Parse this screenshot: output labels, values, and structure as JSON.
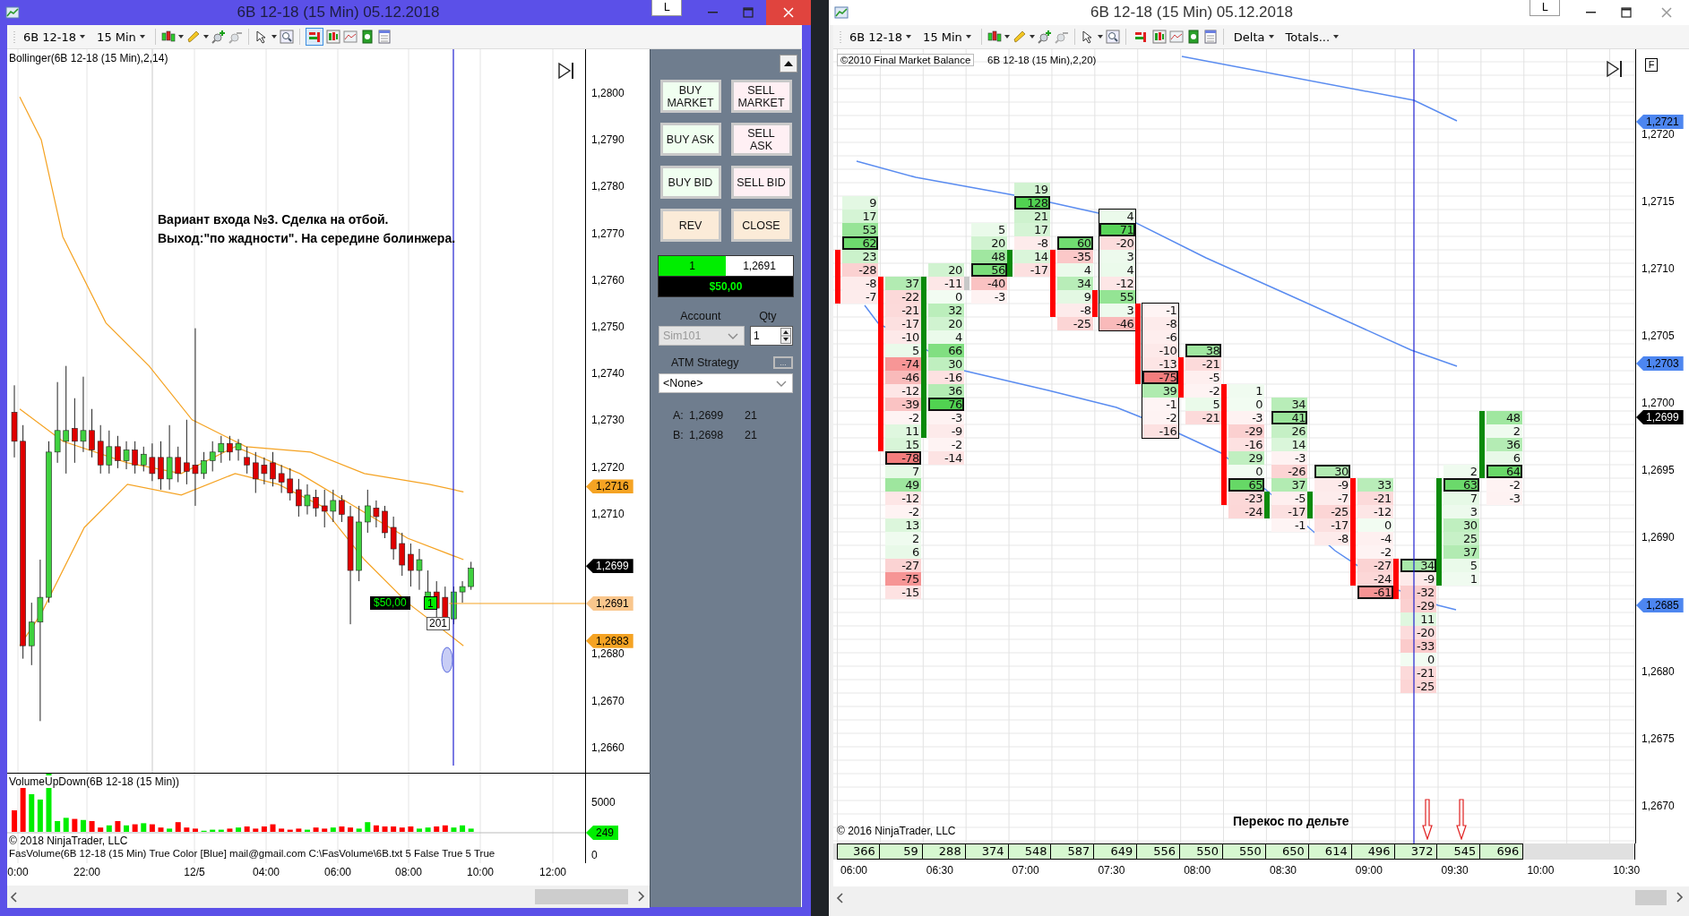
{
  "left_window": {
    "title": "6B 12-18 (15 Min)  05.12.2018",
    "layout_button": "L",
    "toolbar": {
      "instrument": "6B 12-18",
      "interval": "15 Min",
      "order_panel_on": true
    },
    "chart": {
      "indicator_label": "Bollinger(6B 12-18 (15 Min),2,14)",
      "annotation": [
        "Вариант входа №3. Сделка на отбой.",
        "Выход:\"по жадности\". На середине болинжера."
      ],
      "position": {
        "pnl": "$50,00",
        "quantity": "1",
        "bars": "201"
      },
      "price_ticks": [
        "1,2800",
        "1,2790",
        "1,2780",
        "1,2770",
        "1,2760",
        "1,2750",
        "1,2740",
        "1,2730",
        "1,2720",
        "1,2710",
        "1,2680",
        "1,2670",
        "1,2660"
      ],
      "price_markers": [
        {
          "label": "1,2716",
          "kind": "band"
        },
        {
          "label": "1,2699",
          "kind": "last"
        },
        {
          "label": "1,2691",
          "kind": "entry"
        },
        {
          "label": "1,2683",
          "kind": "band"
        }
      ]
    },
    "volume_panel": {
      "label": "VolumeUpDown(6B 12-18 (15 Min))",
      "ticks": [
        "5000",
        "0"
      ],
      "marker": "249"
    },
    "footer": {
      "copyright": "© 2018 NinjaTrader, LLC",
      "indicator": "FasVolume(6B 12-18 (15 Min) True Color [Blue] mail@gmail.com C:\\FasVolume\\6B.txt 5 False True 5 True"
    },
    "time_axis": [
      "0:00",
      "22:00",
      "12/5",
      "04:00",
      "06:00",
      "08:00",
      "10:00",
      "12:00"
    ],
    "order_panel": {
      "buttons": [
        {
          "label": "BUY MARKET",
          "kind": "buy"
        },
        {
          "label": "SELL MARKET",
          "kind": "sell"
        },
        {
          "label": "BUY ASK",
          "kind": "buy"
        },
        {
          "label": "SELL ASK",
          "kind": "sell"
        },
        {
          "label": "BUY BID",
          "kind": "buy"
        },
        {
          "label": "SELL BID",
          "kind": "sell"
        },
        {
          "label": "REV",
          "kind": "neutral"
        },
        {
          "label": "CLOSE",
          "kind": "neutral"
        }
      ],
      "position": {
        "quantity": "1",
        "price": "1,2691",
        "pnl": "$50,00"
      },
      "account": {
        "label": "Account",
        "value": "Sim101",
        "disabled": true
      },
      "qty": {
        "label": "Qty",
        "value": "1"
      },
      "atm": {
        "label": "ATM Strategy",
        "button": "...",
        "value": "<None>"
      },
      "quotes": [
        {
          "side": "A:",
          "price": "1,2699",
          "size": "21"
        },
        {
          "side": "B:",
          "price": "1,2698",
          "size": "21"
        }
      ]
    }
  },
  "right_window": {
    "title": "6B 12-18 (15 Min)  05.12.2018",
    "layout_button": "L",
    "toolbar": {
      "instrument": "6B 12-18",
      "interval": "15 Min",
      "order_panel_on": false,
      "menus": [
        "Delta",
        "Totals..."
      ]
    },
    "chart": {
      "copyright_label": "©2010 Final Market Balance",
      "indicator_label": "6B 12-18 (15 Min),2,20)",
      "corner_button": "F",
      "note": "Перекос по дельте",
      "copyright": "© 2016 NinjaTrader, LLC",
      "columns": [
        {
          "kind": "down",
          "outlined": false,
          "total": "366",
          "cells": [
            {
              "v": "9",
              "boxed": false,
              "body": false
            },
            {
              "v": "17",
              "boxed": false,
              "body": false
            },
            {
              "v": "53",
              "boxed": false,
              "body": false
            },
            {
              "v": "62",
              "boxed": true,
              "body": false
            },
            {
              "v": "23",
              "boxed": false,
              "body": true
            },
            {
              "v": "-28",
              "boxed": false,
              "body": true
            },
            {
              "v": "-8",
              "boxed": false,
              "body": true
            },
            {
              "v": "-7",
              "boxed": false,
              "body": true
            }
          ]
        },
        {
          "kind": "down",
          "outlined": false,
          "total": "59",
          "cells": [
            {
              "v": "37",
              "boxed": false,
              "body": true
            },
            {
              "v": "-22",
              "boxed": false,
              "body": true
            },
            {
              "v": "-21",
              "boxed": false,
              "body": true
            },
            {
              "v": "-17",
              "boxed": false,
              "body": true
            },
            {
              "v": "-10",
              "boxed": false,
              "body": true
            },
            {
              "v": "5",
              "boxed": false,
              "body": true
            },
            {
              "v": "-74",
              "boxed": false,
              "body": true
            },
            {
              "v": "-46",
              "boxed": false,
              "body": true
            },
            {
              "v": "-12",
              "boxed": false,
              "body": true
            },
            {
              "v": "-39",
              "boxed": false,
              "body": true
            },
            {
              "v": "-2",
              "boxed": false,
              "body": true
            },
            {
              "v": "11",
              "boxed": false,
              "body": true
            },
            {
              "v": "15",
              "boxed": false,
              "body": true
            },
            {
              "v": "-78",
              "boxed": true,
              "body": false
            },
            {
              "v": "7",
              "boxed": false,
              "body": false
            },
            {
              "v": "49",
              "boxed": false,
              "body": false
            },
            {
              "v": "-12",
              "boxed": false,
              "body": false
            },
            {
              "v": "-2",
              "boxed": false,
              "body": false
            },
            {
              "v": "13",
              "boxed": false,
              "body": false
            },
            {
              "v": "2",
              "boxed": false,
              "body": false
            },
            {
              "v": "6",
              "boxed": false,
              "body": false
            },
            {
              "v": "-27",
              "boxed": false,
              "body": false
            },
            {
              "v": "-75",
              "boxed": false,
              "body": false
            },
            {
              "v": "-15",
              "boxed": false,
              "body": false
            }
          ]
        },
        {
          "kind": "up",
          "outlined": false,
          "total": "288",
          "cells": [
            {
              "v": "20",
              "boxed": false,
              "body": false
            },
            {
              "v": "-11",
              "boxed": false,
              "body": true
            },
            {
              "v": "0",
              "boxed": false,
              "body": true
            },
            {
              "v": "32",
              "boxed": false,
              "body": true
            },
            {
              "v": "20",
              "boxed": false,
              "body": true
            },
            {
              "v": "4",
              "boxed": false,
              "body": true
            },
            {
              "v": "66",
              "boxed": false,
              "body": true
            },
            {
              "v": "30",
              "boxed": false,
              "body": true
            },
            {
              "v": "-16",
              "boxed": false,
              "body": true
            },
            {
              "v": "36",
              "boxed": false,
              "body": true
            },
            {
              "v": "76",
              "boxed": true,
              "body": true
            },
            {
              "v": "-3",
              "boxed": false,
              "body": true
            },
            {
              "v": "-9",
              "boxed": false,
              "body": true
            },
            {
              "v": "-2",
              "boxed": false,
              "body": false
            },
            {
              "v": "-14",
              "boxed": false,
              "body": false
            }
          ]
        },
        {
          "kind": "flat",
          "outlined": false,
          "total": "374",
          "cells": [
            {
              "v": "5",
              "boxed": false,
              "body": false
            },
            {
              "v": "20",
              "boxed": false,
              "body": false
            },
            {
              "v": "48",
              "boxed": false,
              "body": false
            },
            {
              "v": "56",
              "boxed": true,
              "body": false
            },
            {
              "v": "-40",
              "boxed": false,
              "body": true
            },
            {
              "v": "-3",
              "boxed": false,
              "body": false
            }
          ]
        },
        {
          "kind": "up",
          "outlined": false,
          "total": "548",
          "cells": [
            {
              "v": "19",
              "boxed": false,
              "body": false
            },
            {
              "v": "128",
              "boxed": true,
              "body": false
            },
            {
              "v": "21",
              "boxed": false,
              "body": false
            },
            {
              "v": "17",
              "boxed": false,
              "body": false
            },
            {
              "v": "-8",
              "boxed": false,
              "body": false
            },
            {
              "v": "14",
              "boxed": false,
              "body": true
            },
            {
              "v": "-17",
              "boxed": false,
              "body": true
            }
          ]
        },
        {
          "kind": "down",
          "outlined": false,
          "total": "587",
          "cells": [
            {
              "v": "60",
              "boxed": true,
              "body": false
            },
            {
              "v": "-35",
              "boxed": false,
              "body": true
            },
            {
              "v": "4",
              "boxed": false,
              "body": true
            },
            {
              "v": "34",
              "boxed": false,
              "body": true
            },
            {
              "v": "9",
              "boxed": false,
              "body": true
            },
            {
              "v": "-8",
              "boxed": false,
              "body": true
            },
            {
              "v": "-25",
              "boxed": false,
              "body": false
            }
          ]
        },
        {
          "kind": "down",
          "outlined": true,
          "total": "649",
          "cells": [
            {
              "v": "4",
              "boxed": false,
              "body": false
            },
            {
              "v": "71",
              "boxed": true,
              "body": false
            },
            {
              "v": "-20",
              "boxed": false,
              "body": false
            },
            {
              "v": "3",
              "boxed": false,
              "body": false
            },
            {
              "v": "4",
              "boxed": false,
              "body": false
            },
            {
              "v": "-12",
              "boxed": false,
              "body": false
            },
            {
              "v": "55",
              "boxed": false,
              "body": true
            },
            {
              "v": "3",
              "boxed": false,
              "body": true
            },
            {
              "v": "-46",
              "boxed": false,
              "body": false
            }
          ]
        },
        {
          "kind": "down",
          "outlined": true,
          "total": "556",
          "cells": [
            {
              "v": "-1",
              "boxed": false,
              "body": true
            },
            {
              "v": "-8",
              "boxed": false,
              "body": true
            },
            {
              "v": "-6",
              "boxed": false,
              "body": true
            },
            {
              "v": "-10",
              "boxed": false,
              "body": true
            },
            {
              "v": "-13",
              "boxed": false,
              "body": true
            },
            {
              "v": "-75",
              "boxed": true,
              "body": true
            },
            {
              "v": "39",
              "boxed": false,
              "body": false
            },
            {
              "v": "-1",
              "boxed": false,
              "body": false
            },
            {
              "v": "-2",
              "boxed": false,
              "body": false
            },
            {
              "v": "-16",
              "boxed": false,
              "body": false
            }
          ]
        },
        {
          "kind": "down",
          "outlined": false,
          "total": "550",
          "cells": [
            {
              "v": "38",
              "boxed": true,
              "body": false
            },
            {
              "v": "-21",
              "boxed": false,
              "body": true
            },
            {
              "v": "-5",
              "boxed": false,
              "body": true
            },
            {
              "v": "-2",
              "boxed": false,
              "body": true
            },
            {
              "v": "5",
              "boxed": false,
              "body": false
            },
            {
              "v": "-21",
              "boxed": false,
              "body": false
            }
          ]
        },
        {
          "kind": "down",
          "outlined": false,
          "total": "550",
          "cells": [
            {
              "v": "1",
              "boxed": false,
              "body": true
            },
            {
              "v": "0",
              "boxed": false,
              "body": true
            },
            {
              "v": "-3",
              "boxed": false,
              "body": true
            },
            {
              "v": "-29",
              "boxed": false,
              "body": true
            },
            {
              "v": "-16",
              "boxed": false,
              "body": true
            },
            {
              "v": "29",
              "boxed": false,
              "body": true
            },
            {
              "v": "0",
              "boxed": false,
              "body": true
            },
            {
              "v": "65",
              "boxed": true,
              "body": true
            },
            {
              "v": "-23",
              "boxed": false,
              "body": true
            },
            {
              "v": "-24",
              "boxed": false,
              "body": false
            }
          ]
        },
        {
          "kind": "up",
          "outlined": false,
          "total": "650",
          "cells": [
            {
              "v": "34",
              "boxed": false,
              "body": false
            },
            {
              "v": "41",
              "boxed": true,
              "body": false
            },
            {
              "v": "26",
              "boxed": false,
              "body": false
            },
            {
              "v": "14",
              "boxed": false,
              "body": false
            },
            {
              "v": "-3",
              "boxed": false,
              "body": false
            },
            {
              "v": "-26",
              "boxed": false,
              "body": false
            },
            {
              "v": "37",
              "boxed": false,
              "body": false
            },
            {
              "v": "-5",
              "boxed": false,
              "body": true
            },
            {
              "v": "-17",
              "boxed": false,
              "body": true
            },
            {
              "v": "-1",
              "boxed": false,
              "body": false
            }
          ]
        },
        {
          "kind": "up",
          "outlined": false,
          "total": "614",
          "cells": [
            {
              "v": "30",
              "boxed": true,
              "body": false
            },
            {
              "v": "-9",
              "boxed": false,
              "body": false
            },
            {
              "v": "-7",
              "boxed": false,
              "body": true
            },
            {
              "v": "-25",
              "boxed": false,
              "body": true
            },
            {
              "v": "-17",
              "boxed": false,
              "body": false
            },
            {
              "v": "-8",
              "boxed": false,
              "body": false
            }
          ]
        },
        {
          "kind": "down",
          "outlined": false,
          "total": "496",
          "cells": [
            {
              "v": "33",
              "boxed": false,
              "body": true
            },
            {
              "v": "-21",
              "boxed": false,
              "body": true
            },
            {
              "v": "-12",
              "boxed": false,
              "body": true
            },
            {
              "v": "0",
              "boxed": false,
              "body": true
            },
            {
              "v": "-4",
              "boxed": false,
              "body": true
            },
            {
              "v": "-2",
              "boxed": false,
              "body": true
            },
            {
              "v": "-27",
              "boxed": false,
              "body": true
            },
            {
              "v": "-24",
              "boxed": false,
              "body": true
            },
            {
              "v": "-61",
              "boxed": true,
              "body": false
            }
          ]
        },
        {
          "kind": "down",
          "outlined": false,
          "total": "372",
          "cells": [
            {
              "v": "34",
              "boxed": true,
              "body": true
            },
            {
              "v": "-9",
              "boxed": false,
              "body": true
            },
            {
              "v": "-32",
              "boxed": false,
              "body": true
            },
            {
              "v": "-29",
              "boxed": false,
              "body": false
            },
            {
              "v": "11",
              "boxed": false,
              "body": false
            },
            {
              "v": "-20",
              "boxed": false,
              "body": false
            },
            {
              "v": "-33",
              "boxed": false,
              "body": false
            },
            {
              "v": "0",
              "boxed": false,
              "body": false
            },
            {
              "v": "-21",
              "boxed": false,
              "body": false
            },
            {
              "v": "-25",
              "boxed": false,
              "body": false
            }
          ]
        },
        {
          "kind": "up",
          "outlined": false,
          "total": "545",
          "cells": [
            {
              "v": "2",
              "boxed": false,
              "body": false
            },
            {
              "v": "63",
              "boxed": true,
              "body": true
            },
            {
              "v": "7",
              "boxed": false,
              "body": true
            },
            {
              "v": "3",
              "boxed": false,
              "body": true
            },
            {
              "v": "30",
              "boxed": false,
              "body": true
            },
            {
              "v": "25",
              "boxed": false,
              "body": true
            },
            {
              "v": "37",
              "boxed": false,
              "body": true
            },
            {
              "v": "5",
              "boxed": false,
              "body": true
            },
            {
              "v": "1",
              "boxed": false,
              "body": true
            }
          ]
        },
        {
          "kind": "up",
          "outlined": false,
          "total": "696",
          "cells": [
            {
              "v": "48",
              "boxed": false,
              "body": true
            },
            {
              "v": "2",
              "boxed": false,
              "body": true
            },
            {
              "v": "36",
              "boxed": false,
              "body": true
            },
            {
              "v": "6",
              "boxed": false,
              "body": true
            },
            {
              "v": "64",
              "boxed": true,
              "body": true
            },
            {
              "v": "-2",
              "boxed": false,
              "body": false
            },
            {
              "v": "-3",
              "boxed": false,
              "body": false
            }
          ]
        }
      ],
      "price_ticks": [
        "1,2720",
        "1,2715",
        "1,2710",
        "1,2705",
        "1,2700",
        "1,2695",
        "1,2690",
        "1,2680",
        "1,2675",
        "1,2670"
      ],
      "price_markers": [
        {
          "label": "1,2721",
          "kind": "band"
        },
        {
          "label": "1,2703",
          "kind": "band"
        },
        {
          "label": "1,2699",
          "kind": "last"
        },
        {
          "label": "1,2685",
          "kind": "band"
        }
      ]
    },
    "time_axis": [
      "06:00",
      "06:30",
      "07:00",
      "07:30",
      "08:00",
      "08:30",
      "09:00",
      "09:30",
      "10:00",
      "10:30"
    ]
  }
}
